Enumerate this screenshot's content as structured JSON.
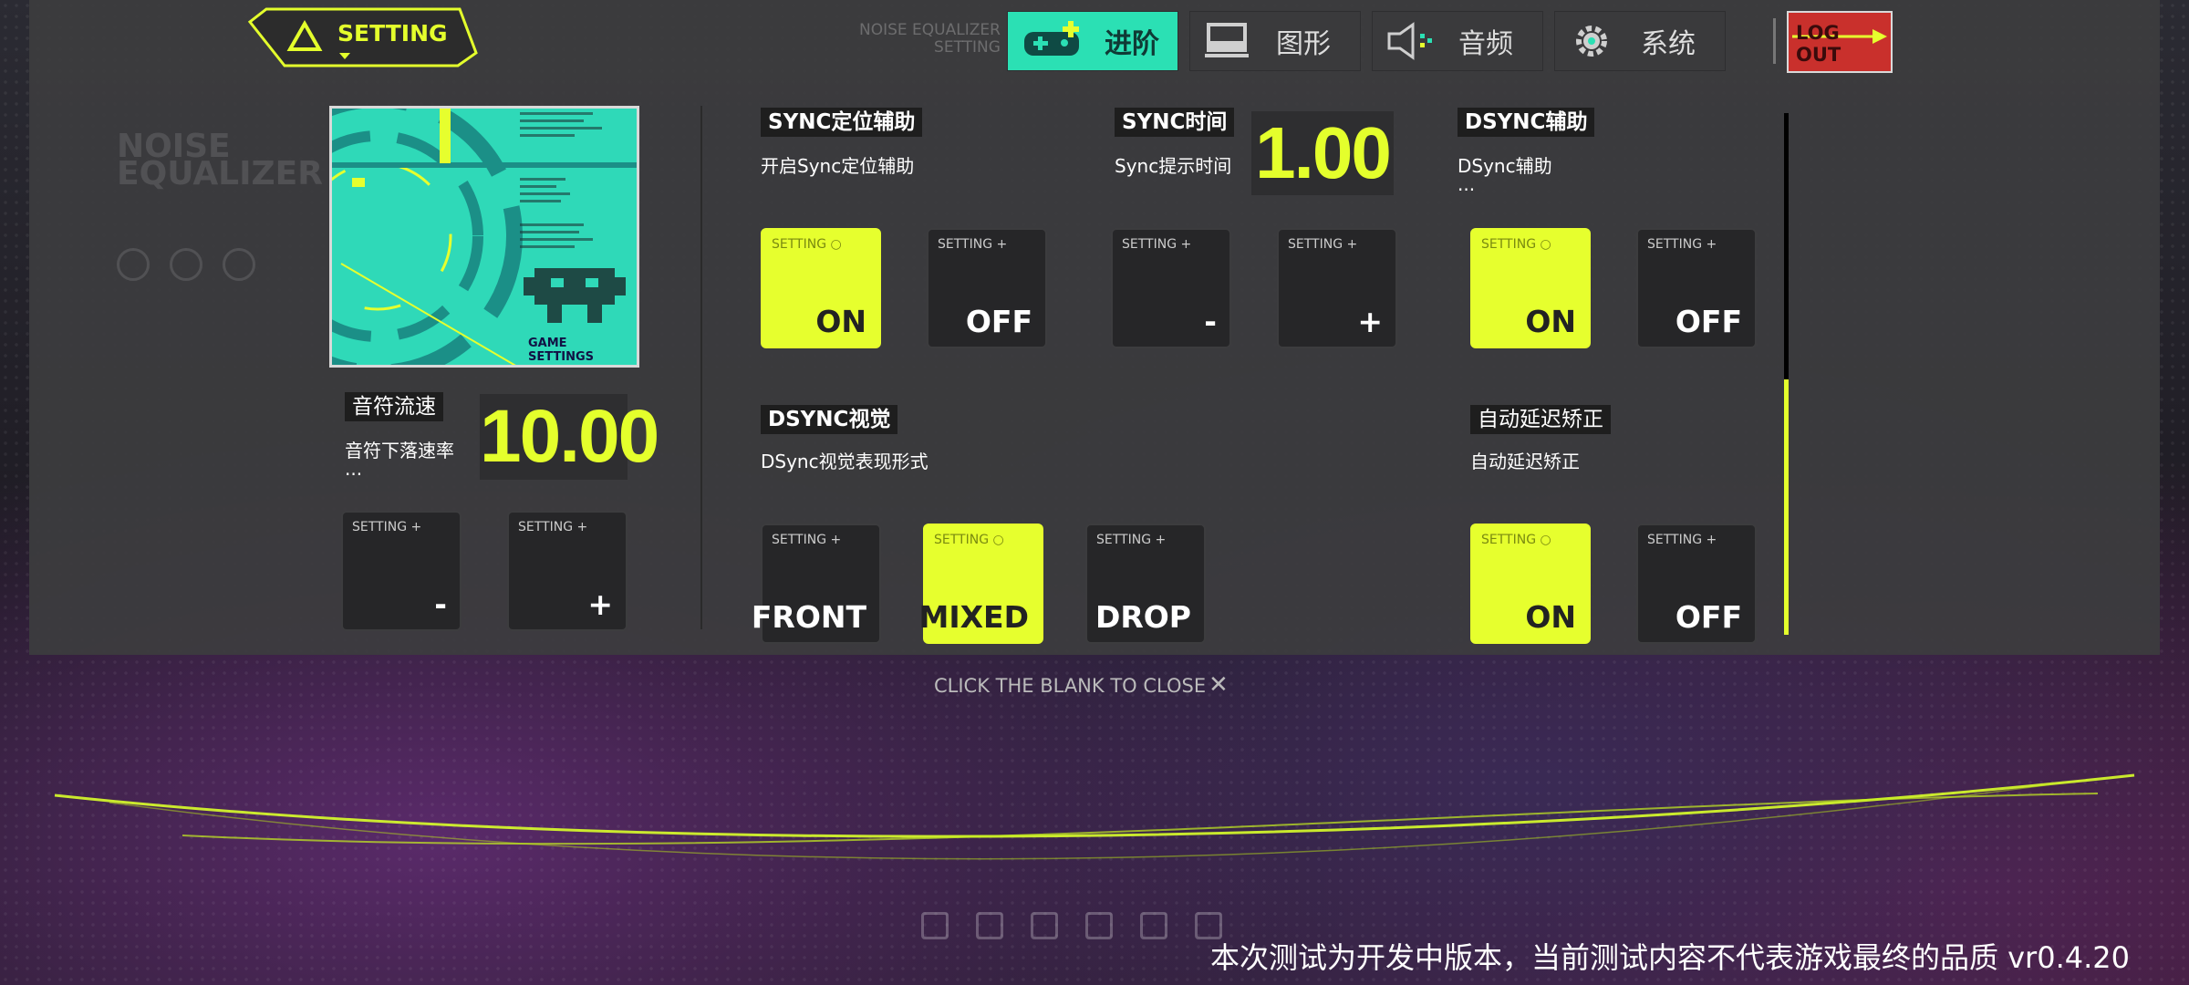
{
  "header": {
    "setting_tab": "SETTING",
    "faint_brand": "NOISE EQUALIZER",
    "faint_sub": "SETTING"
  },
  "nav": {
    "tabs": [
      {
        "label": "进阶",
        "icon": "gamepad-icon",
        "active": true
      },
      {
        "label": "图形",
        "icon": "monitor-icon",
        "active": false
      },
      {
        "label": "音频",
        "icon": "speaker-icon",
        "active": false
      },
      {
        "label": "系统",
        "icon": "gear-icon",
        "active": false
      }
    ],
    "logout": "LOG OUT"
  },
  "brand": {
    "logo_line1": "NOISE",
    "logo_line2": "EQUALIZER"
  },
  "cover": {
    "caption": "GAME SETTINGS"
  },
  "note_speed": {
    "title": "音符流速",
    "desc": "音符下落速率",
    "ellipsis": "...",
    "value": "10.00",
    "option_minus_tag": "SETTING",
    "option_minus": "-",
    "option_plus_tag": "SETTING",
    "option_plus": "+"
  },
  "sync_assist": {
    "title": "SYNC定位辅助",
    "desc": "开启Sync定位辅助",
    "on_tag": "SETTING",
    "on": "ON",
    "off_tag": "SETTING",
    "off": "OFF",
    "selected": "ON"
  },
  "sync_time": {
    "title": "SYNC时间",
    "desc": "Sync提示时间",
    "value": "1.00",
    "minus_tag": "SETTING",
    "minus": "-",
    "plus_tag": "SETTING",
    "plus": "+"
  },
  "dsync_assist": {
    "title": "DSYNC辅助",
    "desc": "DSync辅助",
    "ellipsis": "...",
    "on_tag": "SETTING",
    "on": "ON",
    "off_tag": "SETTING",
    "off": "OFF",
    "selected": "ON"
  },
  "dsync_visual": {
    "title": "DSYNC视觉",
    "desc": "DSync视觉表现形式",
    "front_tag": "SETTING",
    "front": "FRONT",
    "mixed_tag": "SETTING",
    "mixed": "MIXED",
    "drop_tag": "SETTING",
    "drop": "DROP",
    "selected": "MIXED"
  },
  "auto_latency": {
    "title": "自动延迟矫正",
    "desc": "自动延迟矫正",
    "on_tag": "SETTING",
    "on": "ON",
    "off_tag": "SETTING",
    "off": "OFF",
    "selected": "ON"
  },
  "footer": {
    "close_hint": "CLICK THE BLANK TO CLOSE",
    "close_symbol": "✕",
    "disclaimer": "本次测试为开发中版本，当前测试内容不代表游戏最终的品质 vr0.4.20"
  },
  "colors": {
    "accent_yellow": "#e6ff2e",
    "accent_teal": "#2be0b4",
    "logout_red": "#c9302c"
  }
}
